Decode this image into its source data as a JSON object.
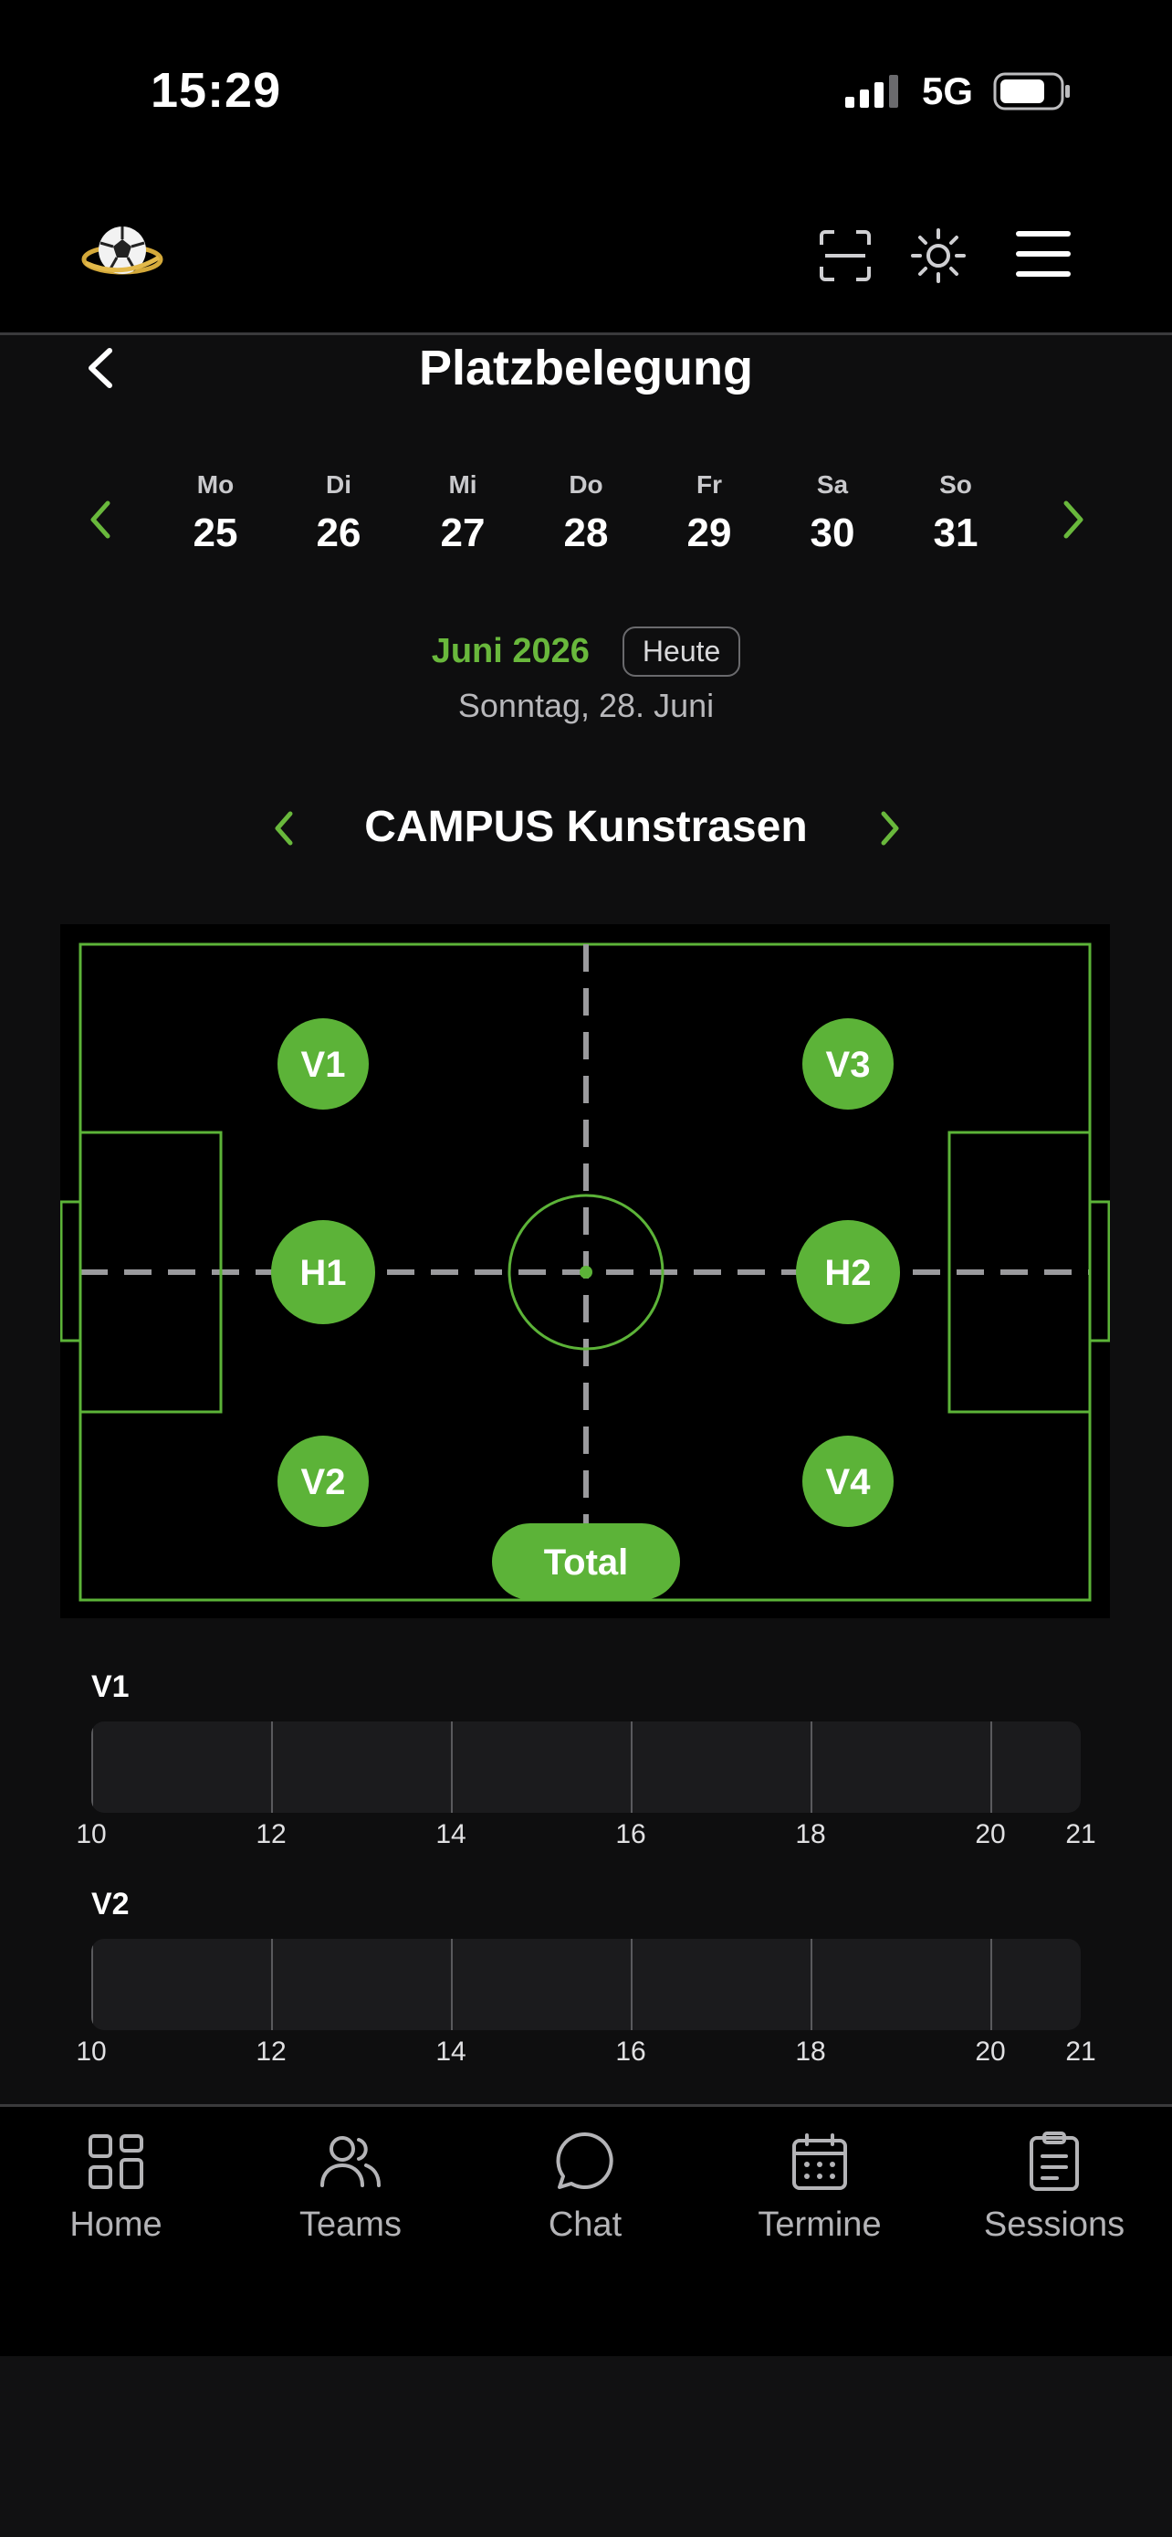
{
  "status_bar": {
    "time": "15:29",
    "network": "5G"
  },
  "page": {
    "title": "Platzbelegung"
  },
  "week": {
    "days": [
      {
        "name": "Mo",
        "num": "25"
      },
      {
        "name": "Di",
        "num": "26"
      },
      {
        "name": "Mi",
        "num": "27"
      },
      {
        "name": "Do",
        "num": "28"
      },
      {
        "name": "Fr",
        "num": "29"
      },
      {
        "name": "Sa",
        "num": "30"
      },
      {
        "name": "So",
        "num": "31"
      }
    ]
  },
  "month": {
    "label": "Juni 2026",
    "today_label": "Heute",
    "selected_date": "Sonntag, 28. Juni"
  },
  "field": {
    "name": "CAMPUS Kunstrasen",
    "zones": {
      "v1": "V1",
      "v2": "V2",
      "v3": "V3",
      "v4": "V4",
      "h1": "H1",
      "h2": "H2",
      "total": "Total"
    }
  },
  "timelines": [
    {
      "label": "V1",
      "ticks": [
        "10",
        "12",
        "14",
        "16",
        "18",
        "20",
        "21"
      ]
    },
    {
      "label": "V2",
      "ticks": [
        "10",
        "12",
        "14",
        "16",
        "18",
        "20",
        "21"
      ]
    }
  ],
  "bottom_nav": [
    {
      "label": "Home",
      "icon": "grid-icon"
    },
    {
      "label": "Teams",
      "icon": "users-icon"
    },
    {
      "label": "Chat",
      "icon": "chat-bubble-icon"
    },
    {
      "label": "Termine",
      "icon": "calendar-icon"
    },
    {
      "label": "Sessions",
      "icon": "clipboard-icon"
    }
  ],
  "colors": {
    "accent": "#69b83c",
    "background": "#0e0e0f",
    "header": "#000000"
  }
}
